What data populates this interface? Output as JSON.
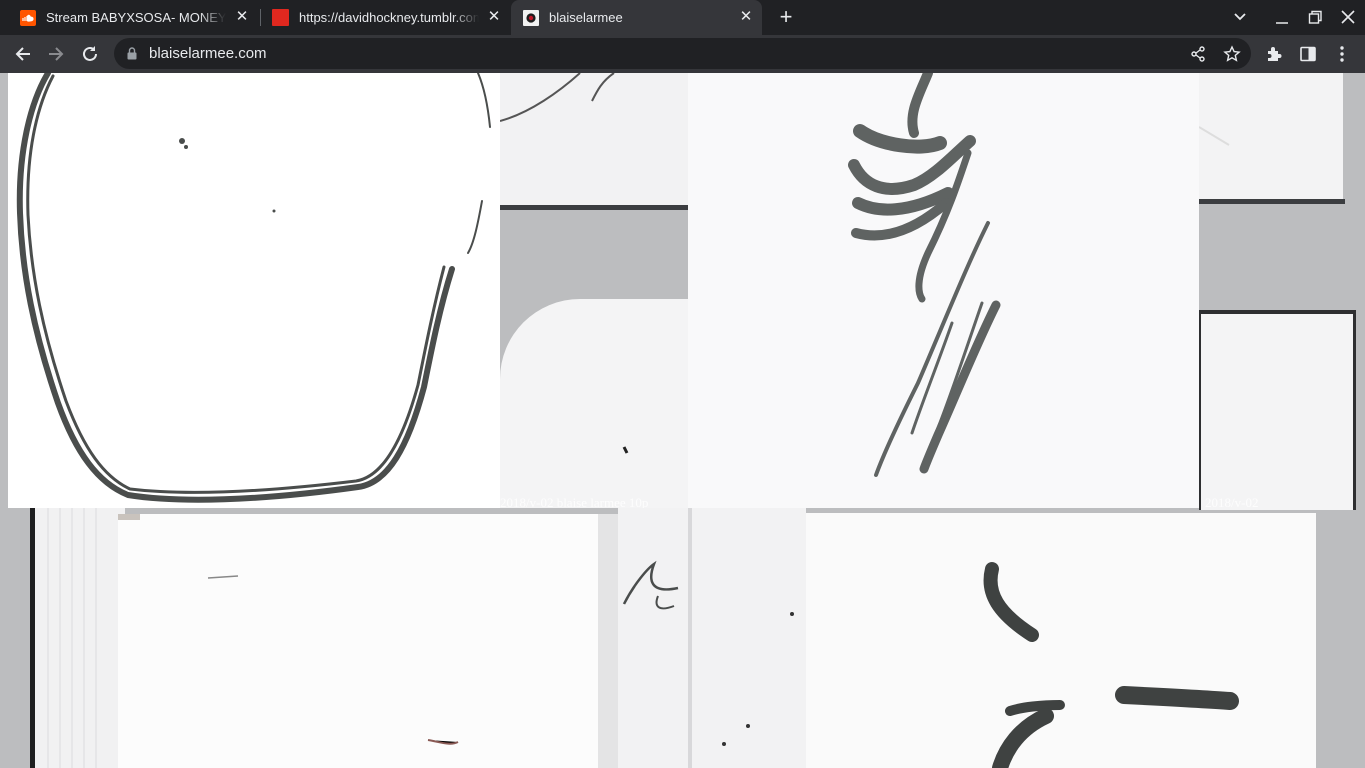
{
  "browser": {
    "tabs": [
      {
        "title": "Stream BABYXSOSA- MONEY BAG",
        "favicon": "soundcloud-icon",
        "active": false
      },
      {
        "title": "https://davidhockney.tumblr.com",
        "favicon": "tumblr-icon",
        "active": false
      },
      {
        "title": "blaiselarmee",
        "favicon": "site-logo-icon",
        "active": true
      }
    ],
    "url": "blaiselarmee.com"
  },
  "page": {
    "caption_left": "2018/v-02 blaise larmee 10p",
    "caption_right": "2018/v-02"
  },
  "colors": {
    "tabstrip": "#202124",
    "toolbar": "#35363a",
    "page_background": "#bcbdbf",
    "ink": "#4a4d4c",
    "soundcloud": "#ff5500",
    "tumblr_favicon": "#e0281f"
  }
}
